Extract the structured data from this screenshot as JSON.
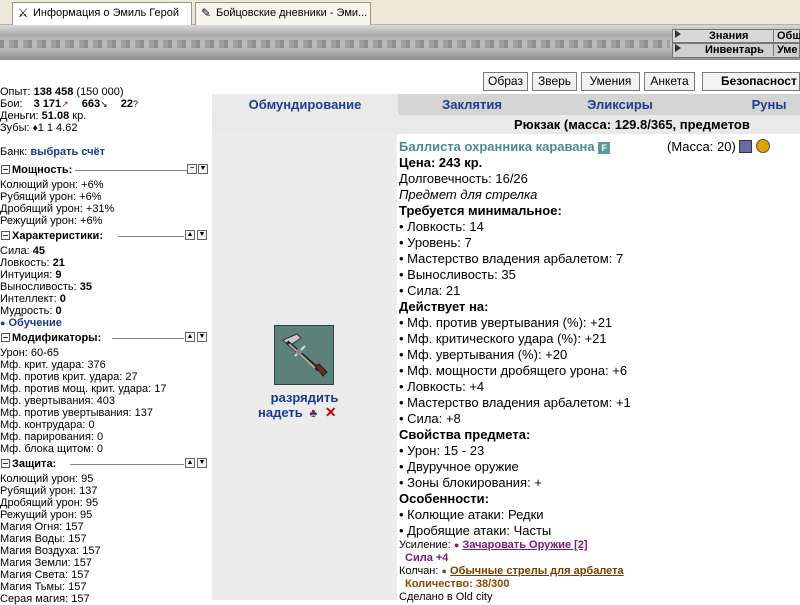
{
  "browser": {
    "tabs": [
      {
        "label": "Информация о Эмиль Герой",
        "icon": "crossed-swords-icon"
      },
      {
        "label": "Бойцовские дневники - Эми...",
        "icon": "quill-icon"
      }
    ]
  },
  "topnav": {
    "row1": [
      "Знания",
      "Общ"
    ],
    "row2": [
      "Инвентарь",
      "Уме"
    ]
  },
  "buttons": [
    "Образ",
    "Зверь",
    "Умения",
    "Анкета",
    "Безопасност"
  ],
  "tabs": [
    "Обмундирование",
    "Заклятия",
    "Эликсиры",
    "Руны"
  ],
  "backpack": "Рюкзак (масса: 129.8/365, предметов",
  "stats": {
    "exp_label": "Опыт:",
    "exp": "138 458",
    "exp_next": "(150 000)",
    "battles_label": "Бои:",
    "wins": "3 171",
    "losses": "663",
    "draws": "22",
    "money_label": "Деньги:",
    "money": "51.08",
    "money_unit": "кр.",
    "teeth_label": "Зубы:",
    "teeth": "1 1 4.62",
    "bank_label": "Банк:",
    "bank_link": "выбрать счёт"
  },
  "power": {
    "title": "Мощность:",
    "items": [
      "Колющий урон: +6%",
      "Рубящий урон: +6%",
      "Дробящий урон: +31%",
      "Режущий урон: +6%"
    ]
  },
  "characteristics": {
    "title": "Характеристики:",
    "items": [
      {
        "label": "Сила:",
        "value": "45"
      },
      {
        "label": "Ловкость:",
        "value": "21"
      },
      {
        "label": "Интуиция:",
        "value": "9"
      },
      {
        "label": "Выносливость:",
        "value": "35"
      },
      {
        "label": "Интеллект:",
        "value": "0"
      },
      {
        "label": "Мудрость:",
        "value": "0"
      }
    ],
    "training_link": "Обучение"
  },
  "modifiers": {
    "title": "Модификаторы:",
    "items": [
      "Урон: 60-65",
      "Мф. крит. удара: 376",
      "Мф. против крит. удара: 27",
      "Мф. против мощ. крит. удара: 17",
      "Мф. увертывания: 403",
      "Мф. против увертывания: 137",
      "Мф. контрудара: 0",
      "Мф. парирования: 0",
      "Мф. блока щитом: 0"
    ]
  },
  "defense": {
    "title": "Защита:",
    "items": [
      "Колющий урон: 95",
      "Рубящий урон: 137",
      "Дробящий урон: 95",
      "Режущий урон: 95",
      "Магия Огня: 157",
      "Магия Воды: 157",
      "Магия Воздуха: 157",
      "Магия Земли: 157",
      "Магия Света: 157",
      "Магия Тьмы: 157",
      "Серая магия: 157"
    ]
  },
  "item": {
    "name": "Баллиста охранника каравана",
    "badge": "F",
    "mass": "(Масса: 20)",
    "price_label": "Цена:",
    "price": "243 кр.",
    "durability": "Долговечность: 16/26",
    "type_note": "Предмет для стрелка",
    "req_title": "Требуется минимальное:",
    "requirements": [
      "• Ловкость: 14",
      "• Уровень: 7",
      "• Мастерство владения арбалетом: 7",
      "• Выносливость: 35",
      "• Сила: 21"
    ],
    "effects_title": "Действует на:",
    "effects": [
      "• Мф. против увертывания (%): +21",
      "• Мф. критического удара (%): +21",
      "• Мф. увертывания (%): +20",
      "• Мф. мощности дробящего урона: +6",
      "• Ловкость: +4",
      "• Мастерство владения арбалетом: +1",
      "• Сила: +8"
    ],
    "props_title": "Свойства предмета:",
    "props": [
      "• Урон: 15 - 23",
      "• Двуручное оружие",
      "• Зоны блокирования: +"
    ],
    "features_title": "Особенности:",
    "features": [
      "• Колющие атаки: Редки",
      "• Дробящие атаки: Часты"
    ],
    "enhance_label": "Усиление:",
    "enhance_link": "Зачаровать Оружие [2]",
    "enhance_value": "Сила +4",
    "quiver_label": "Колчан:",
    "quiver_link": "Обычные стрелы для арбалета",
    "quiver_count": "Количество: 38/300",
    "made_in": "Сделано в Old city",
    "discharge_link": "разрядить",
    "equip_link": "надеть"
  }
}
